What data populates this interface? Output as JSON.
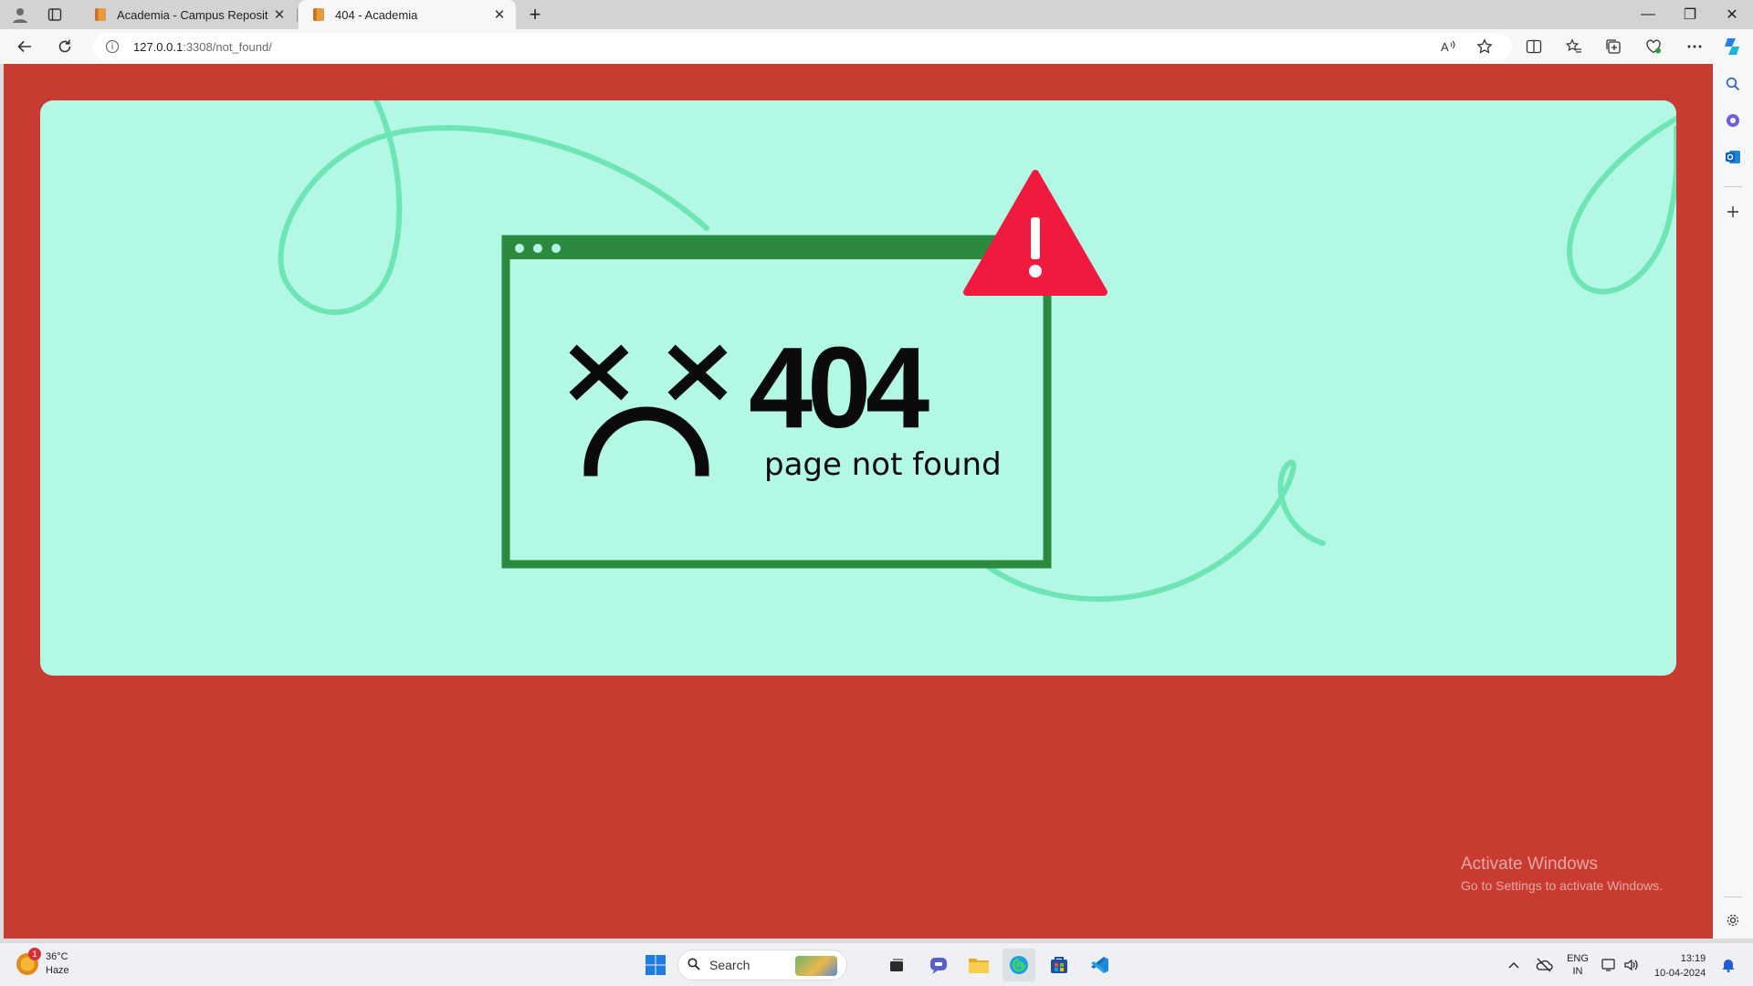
{
  "browser": {
    "tabs": [
      {
        "title": "Academia - Campus Repository",
        "active": false
      },
      {
        "title": "404 - Academia",
        "active": true
      }
    ],
    "url_host": "127.0.0.1",
    "url_rest": ":3308/not_found/",
    "tab_close_glyph": "✕",
    "new_tab_glyph": "+",
    "window_controls": {
      "minimize": "—",
      "restore": "❐",
      "close": "✕"
    }
  },
  "page": {
    "error_code": "404",
    "error_message": "page not found",
    "colors": {
      "background": "#c83b31",
      "card": "#b3f7e5",
      "frame": "#2b8a3e",
      "squiggle": "#6ee5b4",
      "warning": "#f0193e"
    }
  },
  "watermark": {
    "line1": "Activate Windows",
    "line2": "Go to Settings to activate Windows."
  },
  "taskbar": {
    "weather_temp": "36°C",
    "weather_desc": "Haze",
    "weather_badge": "1",
    "search_label": "Search",
    "lang_line1": "ENG",
    "lang_line2": "IN",
    "time": "13:19",
    "date": "10-04-2024"
  }
}
